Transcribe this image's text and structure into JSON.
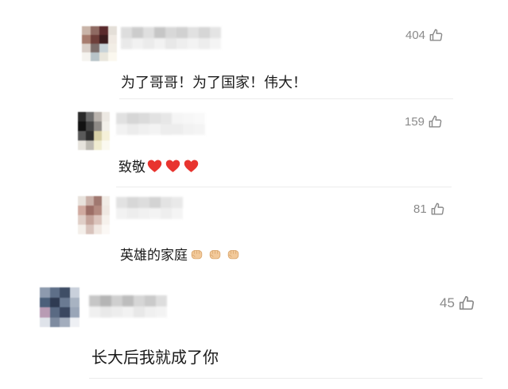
{
  "comments": [
    {
      "likes": "404",
      "text": "为了哥哥！为了国家！伟大！",
      "emoji": [],
      "emoji_name": ""
    },
    {
      "likes": "159",
      "text": "致敬",
      "emoji": [
        "❤",
        "❤",
        "❤"
      ],
      "emoji_name": "red-heart"
    },
    {
      "likes": "81",
      "text": "英雄的家庭",
      "emoji": [
        "✊",
        "✊",
        "✊"
      ],
      "emoji_name": "raised-fist"
    },
    {
      "likes": "45",
      "text": "长大后我就成了你",
      "emoji": [],
      "emoji_name": ""
    }
  ],
  "colors": {
    "like_gray": "#8a8a8a",
    "heart_red": "#e8342f",
    "fist_skin": "#f2c99a",
    "divider": "#ececec"
  },
  "icons": {
    "like": "thumbs-up-outline-icon"
  }
}
